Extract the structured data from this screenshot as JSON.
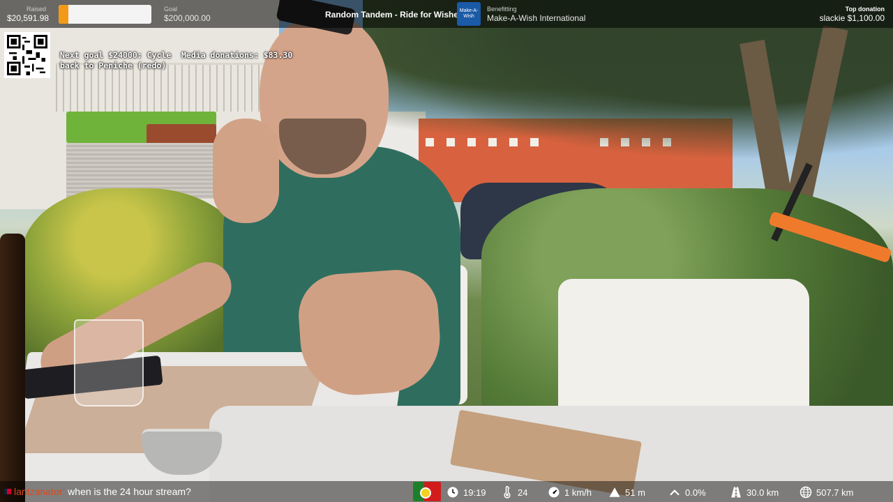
{
  "topbar": {
    "raised_label": "Raised",
    "raised_value": "$20,591.98",
    "progress_fraction": 0.103,
    "goal_label": "Goal",
    "goal_value": "$200,000.00",
    "stream_title": "Random Tandem - Ride for Wishes",
    "charity_logo_text": "Make-A-Wish",
    "benefitting_label": "Benefitting",
    "benefitting_value": "Make-A-Wish International",
    "top_donation_label": "Top donation",
    "top_donation_value": "slackie $1,100.00"
  },
  "overlay": {
    "next_goal": "Next goal $24000: Cycle back to Peniche (redo)",
    "media_donations": "Media donations: $83.30"
  },
  "chat": {
    "username": "lantzanator:",
    "message": "when is the 24 hour stream?"
  },
  "stats": {
    "time": "19:19",
    "temperature": "24",
    "speed": "1 km/h",
    "altitude": "51 m",
    "grade": "0.0%",
    "distance": "30.0 km",
    "total_distance": "507.7 km"
  },
  "icons": {
    "qr": "qr-code-icon",
    "flag": "portugal-flag-icon",
    "clock": "clock-icon",
    "temperature": "thermometer-icon",
    "speed": "speedometer-icon",
    "altitude": "mountain-icon",
    "grade": "incline-icon",
    "distance": "road-icon",
    "total": "globe-icon"
  },
  "colors": {
    "progress_fill": "#f29a18",
    "chat_username": "#d94a1e",
    "charity_blue": "#1a5aa6"
  }
}
